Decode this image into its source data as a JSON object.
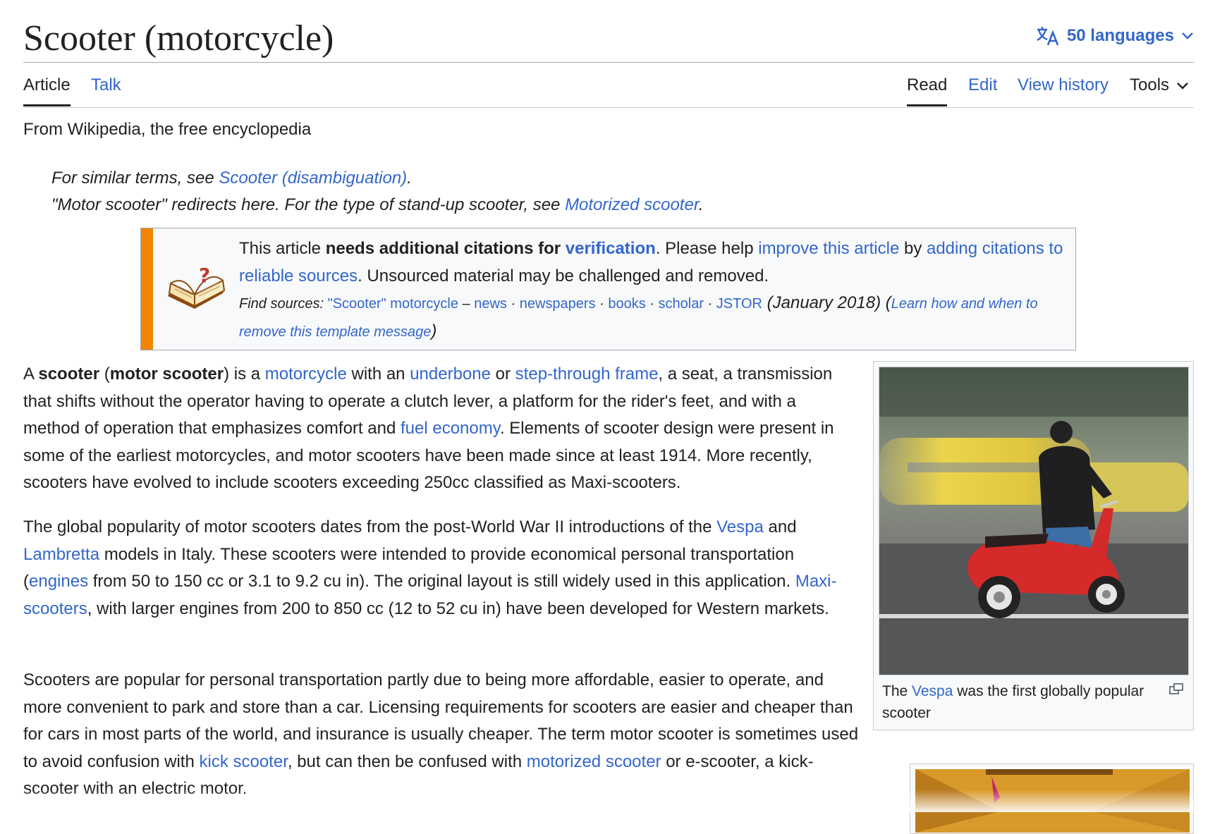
{
  "title": "Scooter (motorcycle)",
  "languages": {
    "label": "50 languages"
  },
  "tabs": {
    "left": [
      {
        "label": "Article"
      },
      {
        "label": "Talk"
      }
    ],
    "right": [
      {
        "label": "Read"
      },
      {
        "label": "Edit"
      },
      {
        "label": "View history"
      },
      {
        "label": "Tools"
      }
    ]
  },
  "tagline": "From Wikipedia, the free encyclopedia",
  "hatnotes": {
    "h1_pre": "For similar terms, see ",
    "h1_link": "Scooter (disambiguation)",
    "h1_post": ".",
    "h2_pre": "\"Motor scooter\" redirects here. For the type of stand-up scooter, see ",
    "h2_link": "Motorized scooter",
    "h2_post": "."
  },
  "ambox": {
    "t1": "This article ",
    "bold": "needs additional citations for ",
    "verification": "verification",
    "t2": ". Please help ",
    "improve": "improve this article",
    "t3": " by ",
    "adding": "adding citations to reliable sources",
    "t4": ". Unsourced material may be challenged and removed.",
    "find": "Find sources: ",
    "src1": "\"Scooter\" motorcycle",
    "dash": " – ",
    "src2": "news",
    "sep": " · ",
    "src3": "newspapers",
    "src4": "books",
    "src5": "scholar",
    "src6": "JSTOR",
    "date": " (January 2018)",
    "paren_open": " (",
    "learn": "Learn how and when to remove this template message",
    "paren_close": ")"
  },
  "para1": {
    "a": "A ",
    "b1": "scooter",
    "c": " (",
    "b2": "motor scooter",
    "d": ") is a ",
    "l1": "motorcycle",
    "e": " with an ",
    "l2": "underbone",
    "f": " or ",
    "l3": "step-through frame",
    "g": ", a seat, a transmission that shifts without the operator having to operate a clutch lever, a platform for the rider's feet, and with a method of operation that emphasizes comfort and ",
    "l4": "fuel economy",
    "h": ". Elements of scooter design were present in some of the earliest motorcycles, and motor scooters have been made since at least 1914. More recently, scooters have evolved to include scooters exceeding 250cc classified as Maxi-scooters."
  },
  "para2": {
    "a": "The global popularity of motor scooters dates from the post-World War II introductions of the ",
    "l1": "Vespa",
    "b": " and ",
    "l2": "Lambretta",
    "c": " models in Italy. These scooters were intended to provide economical personal transportation (",
    "l3": "engines",
    "d": " from 50 to 150 cc or 3.1 to 9.2 cu in). The original layout is still widely used in this application. ",
    "l4": "Maxi-scooters",
    "e": ", with larger engines from 200 to 850 cc (12 to 52 cu in) have been developed for Western markets."
  },
  "para3": {
    "a": "Scooters are popular for personal transportation partly due to being more affordable, easier to operate, and more convenient to park and store than a car. Licensing requirements for scooters are easier and cheaper than for cars in most parts of the world, and insurance is usually cheaper. The term motor scooter is sometimes used to avoid confusion with ",
    "l1": "kick scooter",
    "b": ", but can then be confused with ",
    "l2": "motorized scooter",
    "c": " or e-scooter, a kick-scooter with an electric motor."
  },
  "thumb": {
    "cap_a": "The ",
    "cap_link": "Vespa",
    "cap_b": " was the first globally popular scooter"
  },
  "icons": {
    "language": "translate-icon",
    "chevron": "chevron-down-icon",
    "book": "book-question-icon",
    "enlarge": "enlarge-icon"
  },
  "colors": {
    "link": "#3366cc",
    "ambox_stripe": "#f28500",
    "text": "#202122"
  }
}
